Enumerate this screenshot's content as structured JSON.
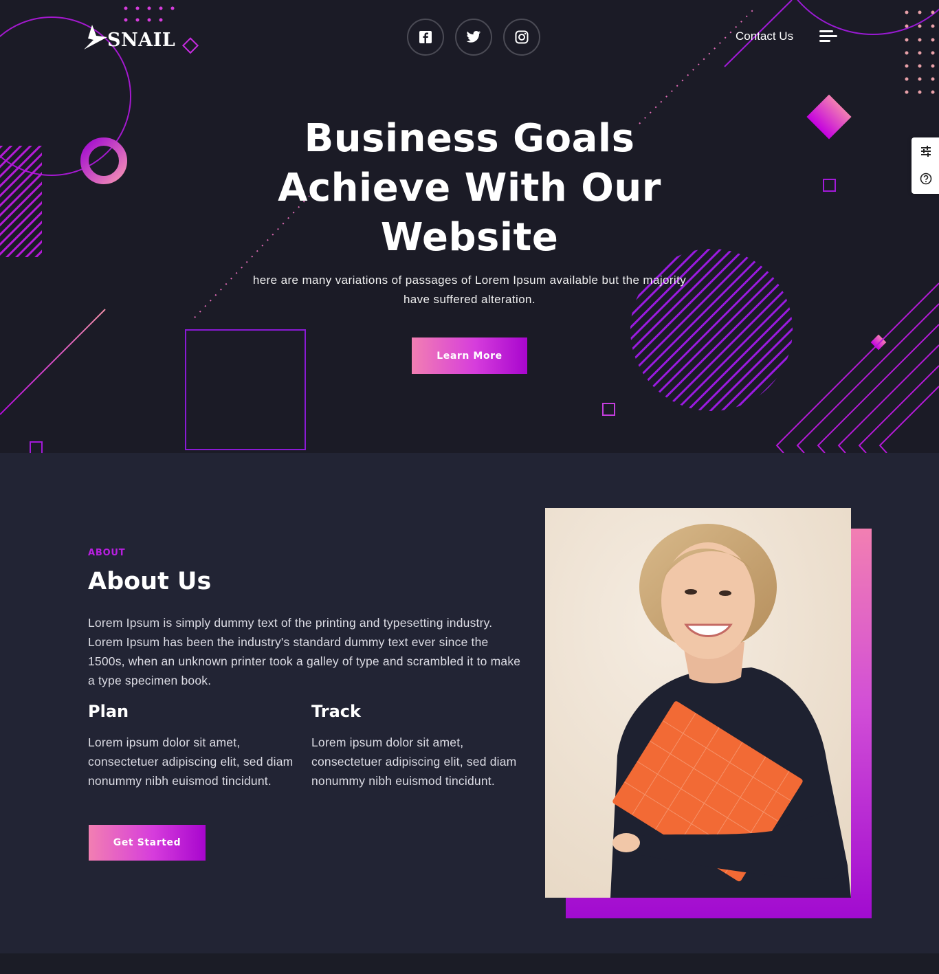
{
  "brand": {
    "name": "SNAIL",
    "logo_icon": "lightning-bolt-icon"
  },
  "nav": {
    "socials": [
      {
        "name": "facebook",
        "icon": "facebook-icon"
      },
      {
        "name": "twitter",
        "icon": "twitter-icon"
      },
      {
        "name": "instagram",
        "icon": "instagram-icon"
      }
    ],
    "contact_label": "Contact Us",
    "menu_icon": "hamburger-menu-icon"
  },
  "side_panel": {
    "icons": [
      "sliders-icon",
      "help-icon"
    ]
  },
  "hero": {
    "title_line1": "Business Goals",
    "title_line2": "Achieve With Our",
    "title_line3": "Website",
    "subtitle_line1": "here are many variations of passages of Lorem Ipsum available but the majority",
    "subtitle_line2": "have suffered alteration.",
    "cta_label": "Learn More"
  },
  "about": {
    "eyebrow": "ABOUT",
    "title": "About Us",
    "body": "Lorem Ipsum is simply dummy text of the printing and typesetting industry. Lorem Ipsum has been the industry's standard dummy text ever since the 1500s, when an unknown printer took a galley of type and scrambled it to make a type specimen book.",
    "columns": [
      {
        "title": "Plan",
        "text": "Lorem ipsum dolor sit amet, consectetuer adipiscing elit, sed diam nonummy nibh euismod tincidunt."
      },
      {
        "title": "Track",
        "text": "Lorem ipsum dolor sit amet, consectetuer adipiscing elit, sed diam nonummy nibh euismod tincidunt."
      }
    ],
    "cta_label": "Get Started"
  },
  "colors": {
    "accent_pink": "#f27fb2",
    "accent_purple": "#a806ce",
    "hero_bg": "#1b1b26",
    "about_bg": "#222434"
  }
}
